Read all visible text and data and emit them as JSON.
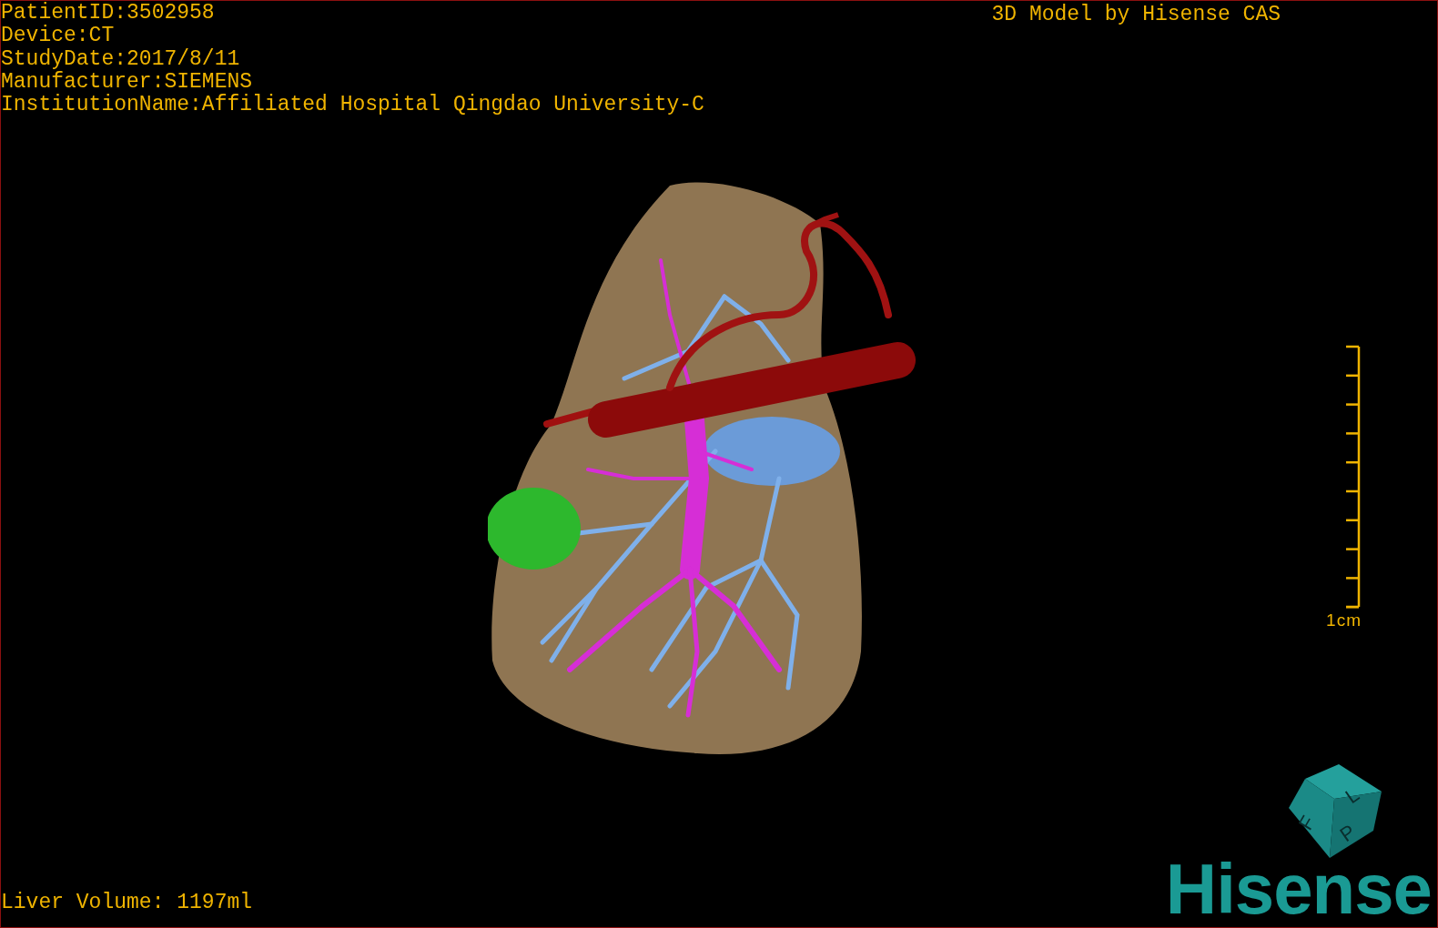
{
  "header": {
    "lines": [
      "PatientID:3502958",
      "Device:CT",
      "StudyDate:2017/8/11",
      "Manufacturer:SIEMENS",
      "InstitutionName:Affiliated Hospital Qingdao University-C"
    ],
    "title": "3D Model by Hisense CAS"
  },
  "scale_bar": {
    "label": "1cm"
  },
  "orientation_cube": {
    "faces": [
      "F",
      "L",
      "P"
    ]
  },
  "footer": {
    "liver_volume": "Liver Volume: 1197ml",
    "logo": "Hisense"
  }
}
